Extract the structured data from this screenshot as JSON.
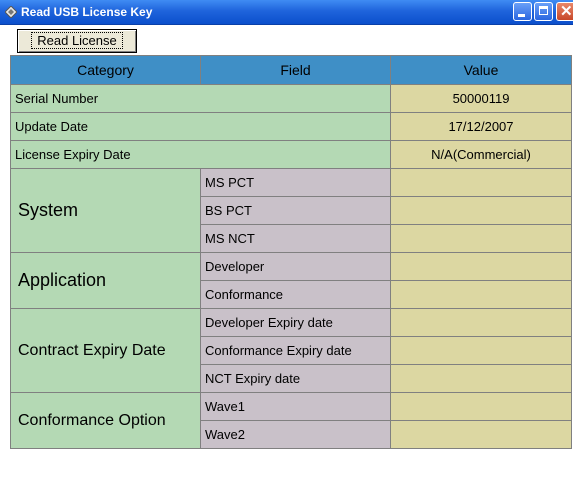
{
  "window": {
    "title": "Read USB License Key",
    "icon": "app-key-icon"
  },
  "toolbar": {
    "read_label": "Read License"
  },
  "grid": {
    "headers": {
      "category": "Category",
      "field": "Field",
      "value": "Value"
    },
    "serial": {
      "label": "Serial Number",
      "value": "50000119"
    },
    "update": {
      "label": "Update Date",
      "value": "17/12/2007"
    },
    "expiry": {
      "label": "License Expiry Date",
      "value": "N/A(Commercial)"
    },
    "groups": {
      "system": {
        "label": "System",
        "fields": [
          "MS PCT",
          "BS PCT",
          "MS NCT"
        ]
      },
      "application": {
        "label": "Application",
        "fields": [
          "Developer",
          "Conformance"
        ]
      },
      "contract": {
        "label": "Contract Expiry Date",
        "fields": [
          "Developer Expiry date",
          "Conformance Expiry date",
          "NCT Expiry date"
        ]
      },
      "conformance_option": {
        "label": "Conformance Option",
        "fields": [
          "Wave1",
          "Wave2"
        ]
      }
    }
  },
  "colors": {
    "header": "#3f8fc6",
    "category_cell": "#b4d9b4",
    "field_cell": "#c9c1c9",
    "value_cell": "#dcd7a2",
    "titlebar": "#1f64dc"
  }
}
